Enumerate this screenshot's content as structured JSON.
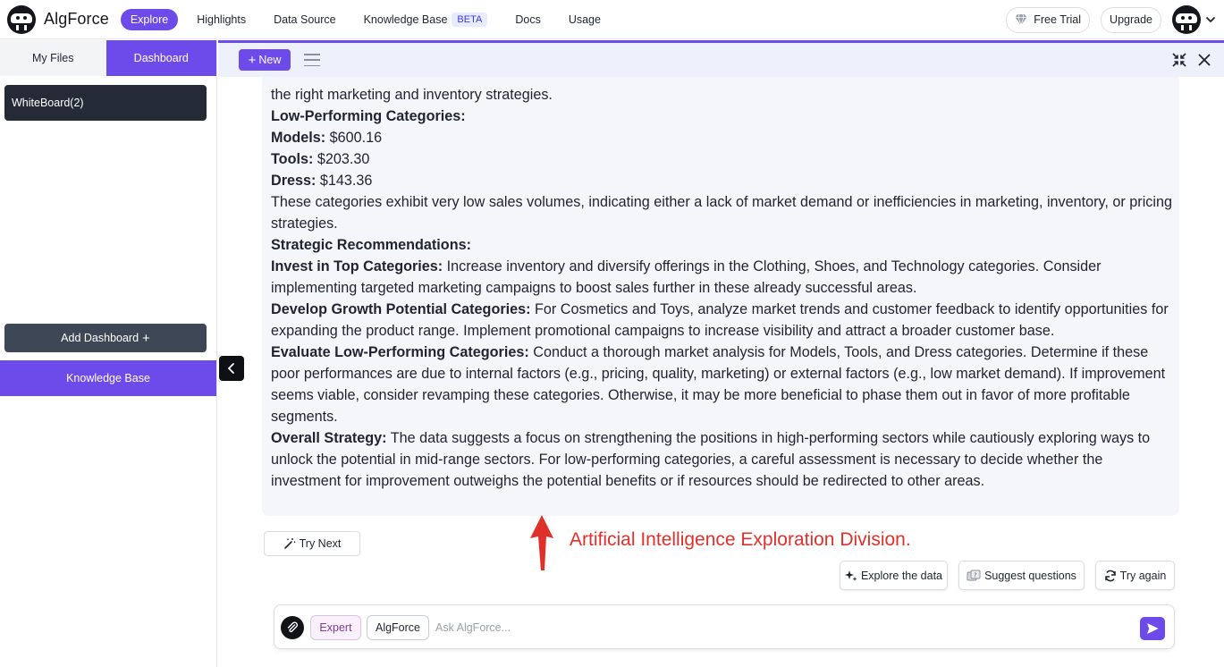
{
  "brand": {
    "name": "AlgForce"
  },
  "nav": {
    "items": [
      {
        "label": "Explore",
        "active": true
      },
      {
        "label": "Highlights"
      },
      {
        "label": "Data Source"
      },
      {
        "label": "Knowledge Base",
        "badge": "BETA"
      },
      {
        "label": "Docs"
      },
      {
        "label": "Usage"
      }
    ]
  },
  "top_right": {
    "free_trial": "Free Trial",
    "upgrade": "Upgrade"
  },
  "sidebar": {
    "tabs": [
      {
        "label": "My Files"
      },
      {
        "label": "Dashboard",
        "active": true
      }
    ],
    "whiteboard": "WhiteBoard(2)",
    "add_dashboard": "Add Dashboard",
    "knowledge_base": "Knowledge Base"
  },
  "toolbar": {
    "new_label": "New"
  },
  "answer": {
    "lines": [
      {
        "text": "the right marketing and inventory strategies."
      },
      {
        "bold": "Low-Performing Categories:"
      },
      {
        "bold": "Models:",
        "text": " $600.16"
      },
      {
        "bold": "Tools:",
        "text": " $203.30"
      },
      {
        "bold": "Dress:",
        "text": " $143.36"
      },
      {
        "text": "These categories exhibit very low sales volumes, indicating either a lack of market demand or inefficiencies in marketing, inventory, or pricing strategies."
      },
      {
        "bold": "Strategic Recommendations:"
      },
      {
        "bold": "Invest in Top Categories:",
        "text": " Increase inventory and diversify offerings in the Clothing, Shoes, and Technology categories. Consider implementing targeted marketing campaigns to boost sales further in these already successful areas."
      },
      {
        "bold": "Develop Growth Potential Categories:",
        "text": " For Cosmetics and Toys, analyze market trends and customer feedback to identify opportunities for expanding the product range. Implement promotional campaigns to increase visibility and attract a broader customer base."
      },
      {
        "bold": "Evaluate Low-Performing Categories:",
        "text": " Conduct a thorough market analysis for Models, Tools, and Dress categories. Determine if these poor performances are due to internal factors (e.g., pricing, quality, marketing) or external factors (e.g., low market demand). If improvement seems viable, consider revamping these categories. Otherwise, it may be more beneficial to phase them out in favor of more profitable segments."
      },
      {
        "bold": "Overall Strategy:",
        "text": " The data suggests a focus on strengthening the positions in high-performing sectors while cautiously exploring ways to unlock the potential in mid-range sectors. For low-performing categories, a careful assessment is necessary to decide whether the investment for improvement outweighs the potential benefits or if resources should be redirected to other areas."
      }
    ]
  },
  "try_next": "Try Next",
  "annotation": "Artificial Intelligence Exploration Division.",
  "actions": {
    "explore": "Explore the data",
    "suggest": "Suggest questions",
    "try_again": "Try again"
  },
  "input": {
    "chip_expert": "Expert",
    "chip_algforce": "AlgForce",
    "placeholder": "Ask AlgForce...",
    "value": ""
  },
  "colors": {
    "accent": "#6d4aea",
    "annotation": "#e0302a",
    "dark_item": "#242a36"
  },
  "icons": {
    "logo": "robot-logo-icon",
    "free_trial": "diamond-icon",
    "avatar": "robot-avatar-icon",
    "menu": "hamburger-icon",
    "collapse": "collapse-arrows-icon",
    "close": "close-icon",
    "sidebar_toggle": "chevron-left-icon",
    "try_next": "magic-wand-icon",
    "explore": "sparkle-icon",
    "suggest": "question-cards-icon",
    "try_again": "refresh-icon",
    "attach": "paperclip-icon",
    "send": "send-icon"
  }
}
